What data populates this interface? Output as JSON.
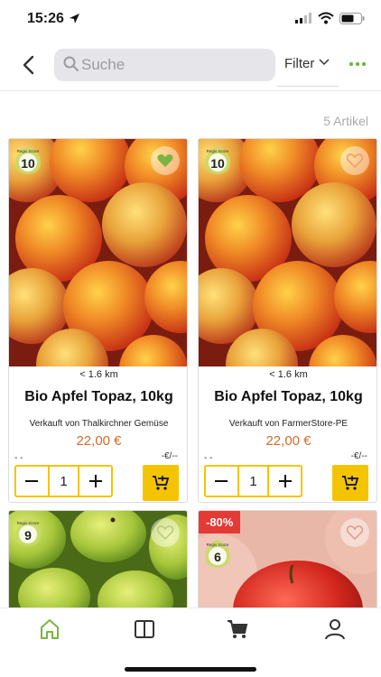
{
  "status_bar": {
    "time": "15:26"
  },
  "header": {
    "search_placeholder": "Suche",
    "filter_label": "Filter"
  },
  "results": {
    "count_label": "5 Artikel"
  },
  "score_label": "Regio Score",
  "products": [
    {
      "score": "10",
      "favorite": true,
      "distance": "< 1.6 km",
      "title": "Bio Apfel Topaz, 10kg",
      "seller": "Verkauft von Thalkirchner Gemüse",
      "price": "22,00 €",
      "base_price_left": "- -",
      "base_price_right": "-€/--",
      "quantity": "1"
    },
    {
      "score": "10",
      "favorite": false,
      "distance": "< 1.6 km",
      "title": "Bio Apfel Topaz, 10kg",
      "seller": "Verkauft von FarmerStore-PE",
      "price": "22,00 €",
      "base_price_left": "- -",
      "base_price_right": "-€/--",
      "quantity": "1"
    },
    {
      "score": "9",
      "favorite": false
    },
    {
      "score": "6",
      "favorite": false,
      "discount": "-80%"
    }
  ],
  "colors": {
    "accent_yellow": "#f5c400",
    "price_orange": "#d46a2a",
    "brand_green": "#7cb342",
    "discount_red": "#e53935"
  }
}
